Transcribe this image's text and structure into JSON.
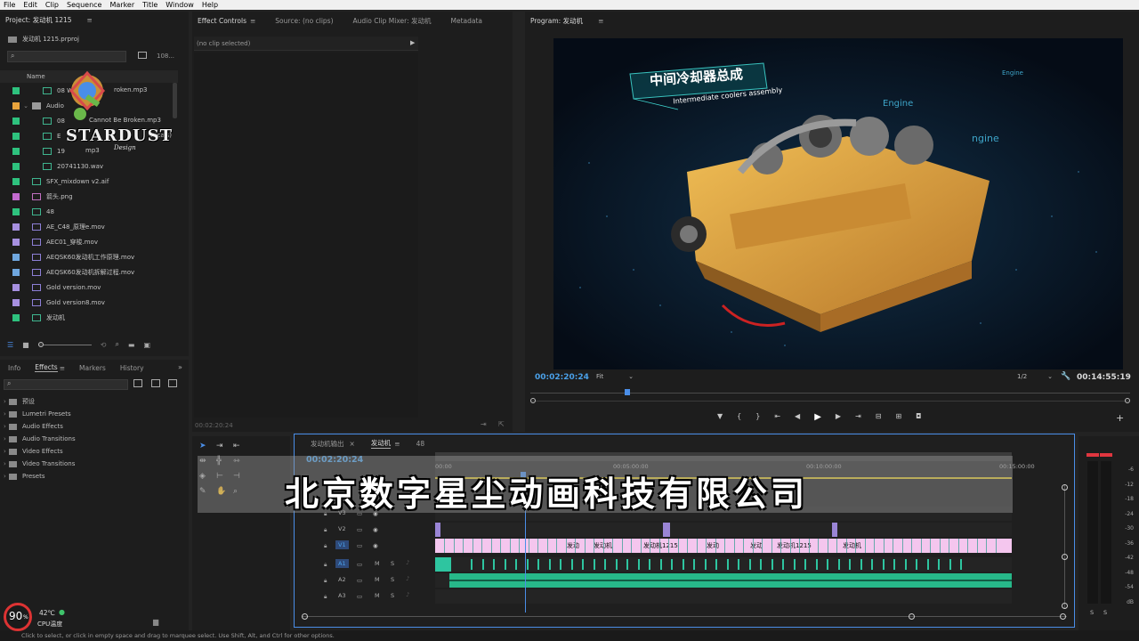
{
  "menu": [
    "File",
    "Edit",
    "Clip",
    "Sequence",
    "Marker",
    "Title",
    "Window",
    "Help"
  ],
  "project": {
    "tab": "Project: 发动机 1215",
    "file": "发动机 1215.prproj",
    "count": "108...",
    "col_name": "Name",
    "items": [
      {
        "color": "#2ec27e",
        "type": "audio",
        "name": "08 W",
        "indent": 1
      },
      {
        "color": "#e8a33c",
        "type": "folder",
        "name": "Audio",
        "indent": 0
      },
      {
        "color": "#2ec27e",
        "type": "audio",
        "name": "08",
        "indent": 1
      },
      {
        "color": "#2ec27e",
        "type": "audio",
        "name": "E",
        "indent": 1
      },
      {
        "color": "#2ec27e",
        "type": "audio",
        "name": "19",
        "indent": 1
      },
      {
        "color": "#2ec27e",
        "type": "audio",
        "name": "20741130.wav",
        "indent": 1
      },
      {
        "color": "#2ec27e",
        "type": "audio",
        "name": "SFX_mixdown v2.aif",
        "indent": 0
      },
      {
        "color": "#c46bd0",
        "type": "image",
        "name": "箭头.png",
        "indent": 0
      },
      {
        "color": "#2ec27e",
        "type": "seq",
        "name": "48",
        "indent": 0
      },
      {
        "color": "#a790e0",
        "type": "video",
        "name": "AE_C48_原理e.mov",
        "indent": 0
      },
      {
        "color": "#a790e0",
        "type": "video",
        "name": "AEC01_穿梭.mov",
        "indent": 0
      },
      {
        "color": "#6fa7df",
        "type": "video",
        "name": "AEQSK60发动机工作原理.mov",
        "indent": 0
      },
      {
        "color": "#6fa7df",
        "type": "video",
        "name": "AEQSK60发动机拆解过程.mov",
        "indent": 0
      },
      {
        "color": "#a790e0",
        "type": "video",
        "name": "Gold version.mov",
        "indent": 0
      },
      {
        "color": "#a790e0",
        "type": "video",
        "name": "Gold version8.mov",
        "indent": 0
      },
      {
        "color": "#2ec27e",
        "type": "seq",
        "name": "发动机",
        "indent": 0
      }
    ],
    "overlay_suffixes": [
      "roken.mp3",
      "Cannot Be Broken.mp3",
      "Vocals)",
      "mp3"
    ]
  },
  "watermark": {
    "logo_text": "STARDUST",
    "logo_sub": "Design"
  },
  "effect_controls": {
    "tabs": [
      "Effect Controls",
      "Source: (no clips)",
      "Audio Clip Mixer: 发动机",
      "Metadata"
    ],
    "no_clip": "(no clip selected)",
    "timecode": "00:02:20:24"
  },
  "program": {
    "tab": "Program: 发动机",
    "timecode": "00:02:20:24",
    "fit": "Fit",
    "quality": "1/2",
    "duration": "00:14:55:19",
    "video_title_cn": "中间冷却器总成",
    "video_title_en": "Intermediate coolers assembly",
    "video_labels": [
      "Engine",
      "Engine",
      "ngine"
    ]
  },
  "effects_panel": {
    "tabs": [
      "Info",
      "Effects",
      "Markers",
      "History"
    ],
    "items": [
      "预设",
      "Lumetri Presets",
      "Audio Effects",
      "Audio Transitions",
      "Video Effects",
      "Video Transitions",
      "Presets"
    ]
  },
  "timeline": {
    "tabs": [
      "发动机输出",
      "发动机",
      "48"
    ],
    "timecode": "00:02:20:24",
    "ruler": [
      "00:00",
      "00:05:00:00",
      "00:10:00:00",
      "00:15:00:00"
    ],
    "tracks_video": [
      "V3",
      "V2",
      "V1"
    ],
    "tracks_audio": [
      "A1",
      "A2",
      "A3"
    ],
    "clip_labels": [
      "发动",
      "发动机",
      "发动机1215",
      "发动",
      "发动",
      "发动机1215",
      "发动机"
    ],
    "banner": "北京数字星尘动画科技有限公司"
  },
  "meter": {
    "scale": [
      "-6",
      "-12",
      "-18",
      "-24",
      "-30",
      "-36",
      "-42",
      "-48",
      "-54",
      "dB"
    ],
    "solo": [
      "S",
      "S"
    ]
  },
  "status": {
    "cpu_percent": "90",
    "cpu_unit": "%",
    "temp": "42℃",
    "temp_label": "CPU温度",
    "hint": "Click to select, or click in empty space and drag to marquee select. Use Shift, Alt, and Ctrl for other options."
  }
}
